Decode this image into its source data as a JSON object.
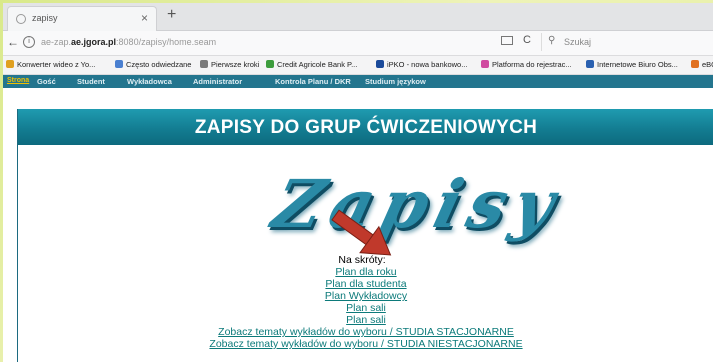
{
  "browser": {
    "tab_title": "zapisy",
    "tab_close": "×",
    "new_tab": "+",
    "back": "←",
    "info": "i",
    "url_prefix": "ae-zap.",
    "url_domain": "ae.jgora.pl",
    "url_suffix": ":8080/zapisy/home.seam",
    "reload": "C",
    "search_placeholder": "Szukaj"
  },
  "bookmarks": [
    {
      "label": "Konwerter wideo z Yo...",
      "color": "#e0a020"
    },
    {
      "label": "Często odwiedzane",
      "color": "#4a7fd0"
    },
    {
      "label": "Pierwsze kroki",
      "color": "#7a7a7a"
    },
    {
      "label": "Credit Agricole Bank P...",
      "color": "#3c9c3c"
    },
    {
      "label": "iPKO - nowa bankowo...",
      "color": "#1a4a9a"
    },
    {
      "label": "Platforma do rejestrac...",
      "color": "#d04aa0"
    },
    {
      "label": "Internetowe Biuro Obs...",
      "color": "#2a60b0"
    },
    {
      "label": "eBOK",
      "color": "#e07020"
    }
  ],
  "site_menu": {
    "home": "Strona",
    "items": [
      "Gość",
      "Student",
      "Wykładowca",
      "Administrator",
      "Kontrola Planu / DKR",
      "Studium językow"
    ]
  },
  "page": {
    "banner_title": "ZAPISY DO GRUP ĆWICZENIOWYCH",
    "logo_text": "Zapisy",
    "shortcuts_title": "Na skróty:",
    "links": [
      "Plan dla roku",
      "Plan dla studenta",
      "Plan Wykładowcy",
      "Plan sali",
      "Plan sali",
      "Zobacz tematy wykładów do wyboru / STUDIA STACJONARNE",
      "Zobacz tematy wykładów do wyboru / STUDIA NIESTACJONARNE"
    ]
  },
  "colors": {
    "accent": "#23758e",
    "banner": "#137d92",
    "link": "#0c7a7a",
    "annotation_arrow": "#c0392b"
  }
}
